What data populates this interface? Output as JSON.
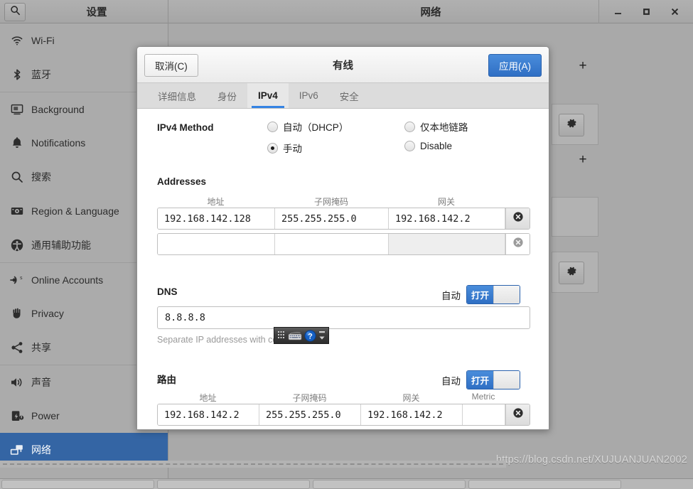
{
  "window": {
    "settings_title": "设置",
    "network_title": "网络",
    "search_icon": "search-icon",
    "controls": {
      "minimize": "_",
      "maximize": "□",
      "close": "✕"
    }
  },
  "sidebar": {
    "items": [
      {
        "label": "Wi-Fi",
        "icon": "wifi-icon",
        "separator": false,
        "active": false
      },
      {
        "label": "蓝牙",
        "icon": "bluetooth-icon",
        "separator": false,
        "active": false
      },
      {
        "label": "Background",
        "icon": "background-icon",
        "separator": true,
        "active": false
      },
      {
        "label": "Notifications",
        "icon": "bell-icon",
        "separator": false,
        "active": false
      },
      {
        "label": "搜索",
        "icon": "search-icon",
        "separator": false,
        "active": false
      },
      {
        "label": "Region & Language",
        "icon": "region-language-icon",
        "separator": false,
        "active": false
      },
      {
        "label": "通用辅助功能",
        "icon": "accessibility-icon",
        "separator": false,
        "active": false
      },
      {
        "label": "Online Accounts",
        "icon": "online-accounts-icon",
        "separator": true,
        "active": false
      },
      {
        "label": "Privacy",
        "icon": "privacy-hand-icon",
        "separator": false,
        "active": false
      },
      {
        "label": "共享",
        "icon": "sharing-icon",
        "separator": false,
        "active": false
      },
      {
        "label": "声音",
        "icon": "sound-icon",
        "separator": true,
        "active": false
      },
      {
        "label": "Power",
        "icon": "power-battery-icon",
        "separator": false,
        "active": false
      },
      {
        "label": "网络",
        "icon": "network-icon",
        "separator": false,
        "active": true
      }
    ]
  },
  "network_panel": {
    "add_label": "+",
    "gear_label": "gear-icon"
  },
  "dialog": {
    "title": "有线",
    "cancel_label": "取消(C)",
    "apply_label": "应用(A)",
    "tabs": [
      {
        "label": "详细信息",
        "active": false
      },
      {
        "label": "身份",
        "active": false
      },
      {
        "label": "IPv4",
        "active": true
      },
      {
        "label": "IPv6",
        "active": false
      },
      {
        "label": "安全",
        "active": false
      }
    ],
    "ipv4_method": {
      "label": "IPv4 Method",
      "options": [
        {
          "label": "自动（DHCP）",
          "selected": false
        },
        {
          "label": "手动",
          "selected": true
        },
        {
          "label": "仅本地链路",
          "selected": false
        },
        {
          "label": "Disable",
          "selected": false
        }
      ]
    },
    "addresses": {
      "title": "Addresses",
      "headers": [
        "地址",
        "子网掩码",
        "网关"
      ],
      "rows": [
        {
          "address": "192.168.142.128",
          "netmask": "255.255.255.0",
          "gateway": "192.168.142.2"
        },
        {
          "address": "",
          "netmask": "",
          "gateway": ""
        }
      ],
      "delete_icon": "delete-circle-icon"
    },
    "dns": {
      "title": "DNS",
      "auto_label": "自动",
      "toggle_state": "打开",
      "value": "8.8.8.8",
      "hint": "Separate IP addresses with commas"
    },
    "routes": {
      "title": "路由",
      "auto_label": "自动",
      "toggle_state": "打开",
      "headers": [
        "地址",
        "子网掩码",
        "网关",
        "Metric"
      ],
      "rows": [
        {
          "address": "192.168.142.2",
          "netmask": "255.255.255.0",
          "gateway": "192.168.142.2",
          "metric": ""
        }
      ],
      "delete_icon": "delete-circle-icon"
    }
  },
  "ime_toolbar": {
    "items": [
      "ime-grid-icon",
      "ime-keyboard-icon",
      "ime-help-icon",
      "ime-collapse-icon"
    ]
  },
  "watermark": "https://blog.csdn.net/XUJUANJUAN2002",
  "colors": {
    "accent": "#3465a4",
    "dialog_accent": "#3584e4",
    "sidebar_bg": "#ababab",
    "window_bg": "#a9a9a9"
  }
}
